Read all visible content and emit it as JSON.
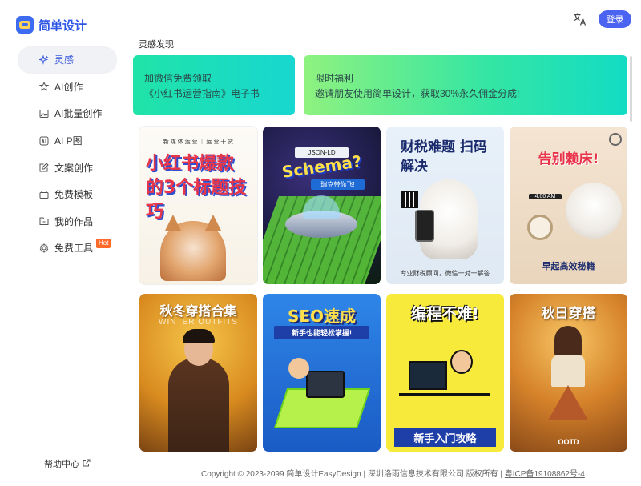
{
  "brand": {
    "name": "简单设计"
  },
  "nav": {
    "items": [
      {
        "label": "灵感",
        "icon": "sparkle-icon"
      },
      {
        "label": "AI创作",
        "icon": "star-icon"
      },
      {
        "label": "AI批量创作",
        "icon": "image-icon"
      },
      {
        "label": "AI P图",
        "icon": "ai-badge-icon"
      },
      {
        "label": "文案创作",
        "icon": "edit-icon"
      },
      {
        "label": "免费模板",
        "icon": "template-icon"
      },
      {
        "label": "我的作品",
        "icon": "folder-icon"
      },
      {
        "label": "免费工具",
        "icon": "gear-icon",
        "badge": "Hot"
      }
    ]
  },
  "help": {
    "label": "帮助中心"
  },
  "header": {
    "login_label": "登录"
  },
  "section": {
    "title": "灵感发现"
  },
  "banners": [
    {
      "line1": "加微信免费领取",
      "line2": "《小红书运营指南》电子书"
    },
    {
      "line1": "限时福利",
      "line2": "邀请朋友使用简单设计，获取30%永久佣金分成!"
    }
  ],
  "cards": [
    {
      "top": "新 媒 体 运 营 ｜ 运 营 干 货",
      "title": "小红书爆款的3个标题技巧",
      "sub": ""
    },
    {
      "top": "JSON-LD",
      "title": "Schema?",
      "sub": "瑞克带你飞!"
    },
    {
      "top": "",
      "title": "财税难题 扫码解决",
      "sub": "专业财税顾问，微信一对一解答"
    },
    {
      "top": "4:00 AM",
      "title": "告别赖床!",
      "sub": "早起高效秘籍"
    },
    {
      "top": "WINTER OUTFITS",
      "title": "秋冬穿搭合集",
      "sub": ""
    },
    {
      "top": "",
      "title": "SEO速成",
      "sub": "新手也能轻松掌握!"
    },
    {
      "top": "",
      "title": "编程不难!",
      "sub": "新手入门攻略"
    },
    {
      "top": "",
      "title": "秋日穿搭",
      "sub": "OOTD"
    }
  ],
  "footer": {
    "copyright": "Copyright © 2023-2099 简单设计EasyDesign | 深圳洛雨信息技术有限公司 版权所有 | ",
    "icp": "粤ICP备19108862号-4"
  },
  "colors": {
    "accent": "#4a63f0",
    "brand": "#2e55e8",
    "hot": "#ff6a2a"
  }
}
